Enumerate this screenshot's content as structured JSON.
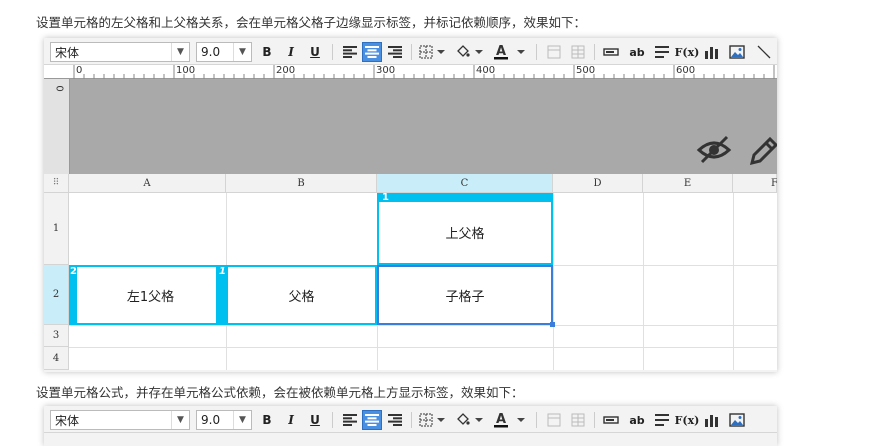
{
  "paragraph1": "设置单元格的左父格和上父格关系，会在单元格父格子边缘显示标签，并标记依赖顺序，效果如下：",
  "paragraph2": "设置单元格公式，并存在单元格公式依赖，会在被依赖单元格上方显示标签，效果如下：",
  "toolbar": {
    "font_family": "宋体",
    "font_size": "9.0",
    "bold": "B",
    "italic": "I",
    "underline": "U",
    "text_label": "ab",
    "formula_label": "F(x)"
  },
  "ruler": {
    "ticks": [
      "0",
      "100",
      "200",
      "300",
      "400",
      "500",
      "600"
    ],
    "vertical_zero": "0"
  },
  "sheet": {
    "corner": "⠿",
    "columns": [
      "A",
      "B",
      "C",
      "D",
      "E",
      "F"
    ],
    "rows": [
      "1",
      "2",
      "3",
      "4"
    ],
    "cells": {
      "c1": "上父格",
      "a2": "左1父格",
      "b2": "父格",
      "c2": "子格子"
    },
    "tags": {
      "c1": "1",
      "a2": "2",
      "b2": "1"
    }
  },
  "colors": {
    "accent": "#00c0f0",
    "selection": "#3b7ddd",
    "header_highlight": "#c9eefa"
  },
  "icons": [
    "eye-slash-icon",
    "pencil-icon",
    "border-icon",
    "fill-color-icon",
    "font-color-icon",
    "merge-cells-icon",
    "image-icon",
    "chart-icon"
  ]
}
